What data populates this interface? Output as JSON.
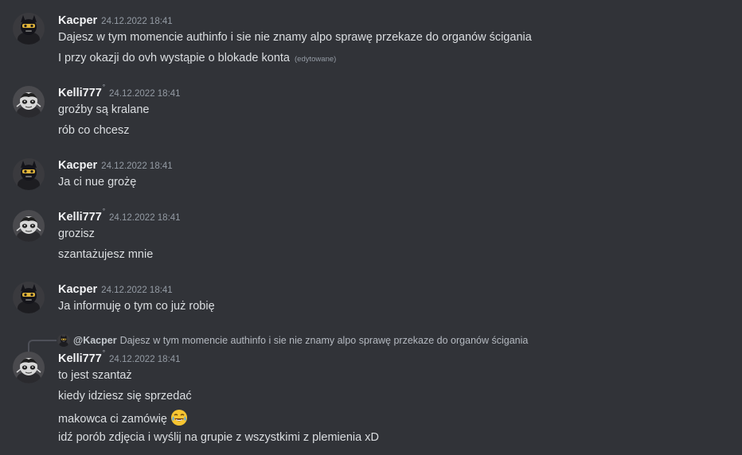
{
  "users": {
    "kacper": {
      "name": "Kacper"
    },
    "kelli": {
      "name": "Kelli777",
      "badge": "°"
    }
  },
  "messages": [
    {
      "author": "Kacper",
      "timestamp": "24.12.2022 18:41",
      "lines": [
        "Dajesz w tym momencie authinfo i sie nie znamy alpo sprawę przekaze do organów ścigania",
        "I przy okazji do ovh wystąpie o blokade konta"
      ],
      "edited_label": "(edytowane)"
    },
    {
      "author": "Kelli777",
      "timestamp": "24.12.2022 18:41",
      "lines": [
        "groźby są kralane",
        "rób co chcesz"
      ]
    },
    {
      "author": "Kacper",
      "timestamp": "24.12.2022 18:41",
      "lines": [
        "Ja ci nue grożę"
      ]
    },
    {
      "author": "Kelli777",
      "timestamp": "24.12.2022 18:41",
      "lines": [
        "grozisz",
        "szantażujesz mnie"
      ]
    },
    {
      "author": "Kacper",
      "timestamp": "24.12.2022 18:41",
      "lines": [
        "Ja informuję o tym  co już robię"
      ]
    },
    {
      "author": "Kelli777",
      "timestamp": "24.12.2022 18:41",
      "reply": {
        "author": "@Kacper",
        "text": "Dajesz w tym momencie authinfo i sie nie znamy alpo sprawę przekaze do organów ścigania"
      },
      "lines": [
        "to jest szantaż",
        "kiedy idziesz się sprzedać",
        "makowca ci zamówię",
        "idź porób zdjęcia i wyślij na grupie z wszystkimi z plemienia xD"
      ],
      "emoji": "joy-emoji"
    }
  ],
  "colors": {
    "background": "#313338",
    "text": "#dbdee1",
    "username": "#f2f3f5",
    "timestamp": "#949ba4"
  }
}
